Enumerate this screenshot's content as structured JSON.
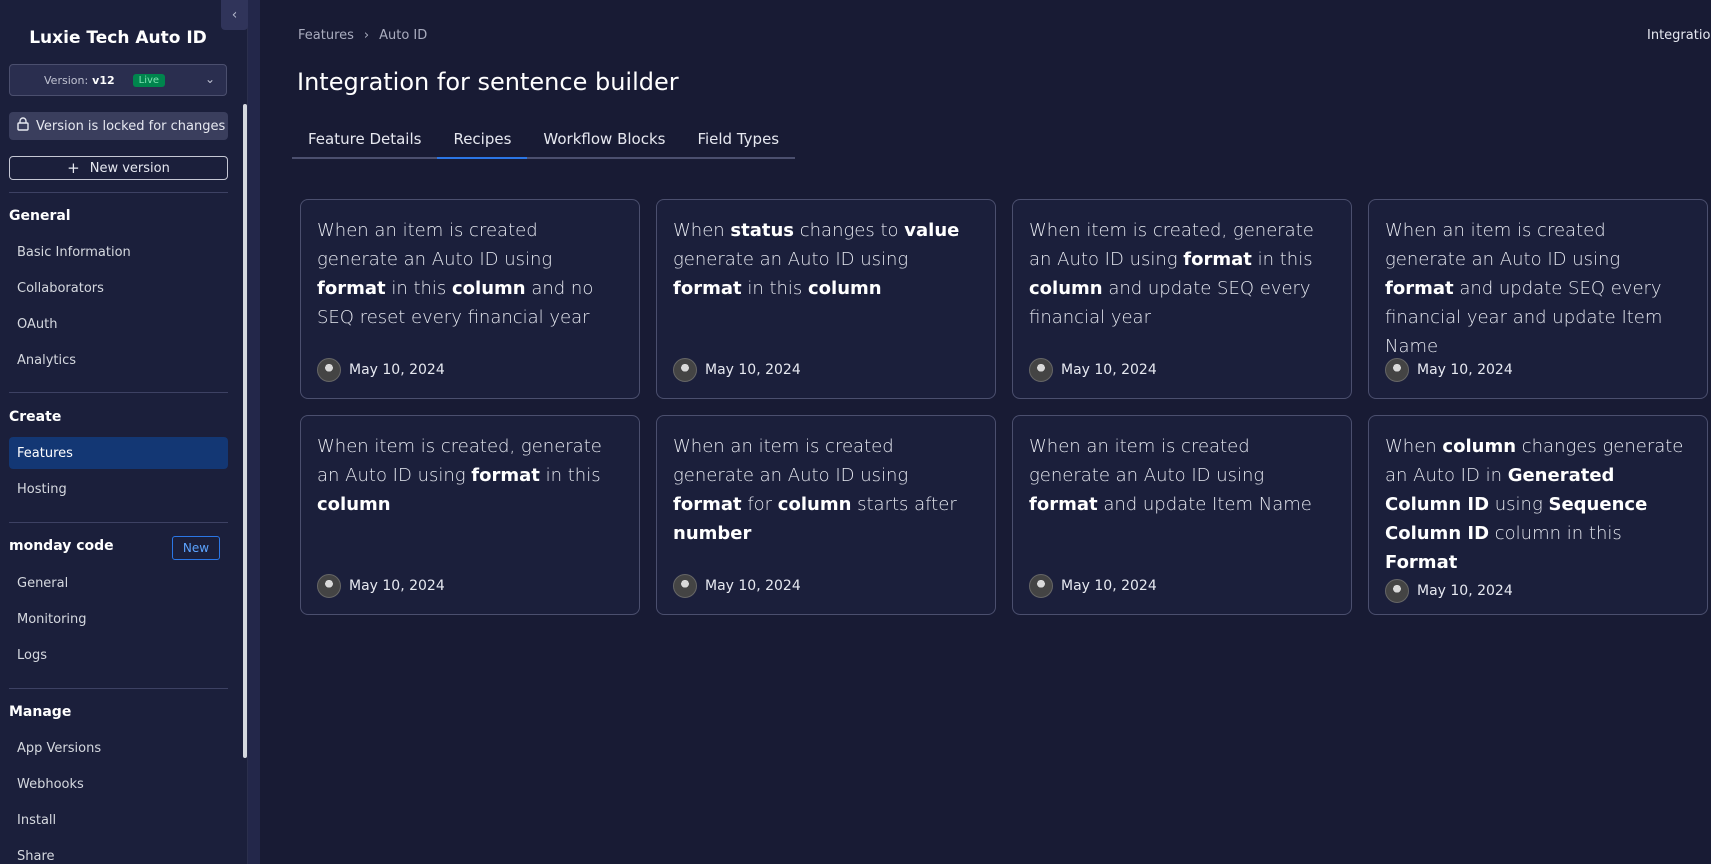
{
  "sidebar": {
    "app_title": "Luxie Tech Auto ID",
    "collapse_icon": "chevron-left-icon",
    "version": {
      "prefix": "Version:",
      "value": "v12",
      "status": "Live"
    },
    "locked_text": "Version is locked for changes",
    "new_version_label": "New version",
    "sections": {
      "general": {
        "title": "General",
        "items": [
          "Basic Information",
          "Collaborators",
          "OAuth",
          "Analytics"
        ]
      },
      "create": {
        "title": "Create",
        "items": [
          "Features",
          "Hosting"
        ],
        "active": "Features"
      },
      "monday_code": {
        "title": "monday code",
        "badge": "New",
        "items": [
          "General",
          "Monitoring",
          "Logs"
        ]
      },
      "manage": {
        "title": "Manage",
        "items": [
          "App Versions",
          "Webhooks",
          "Install",
          "Share"
        ]
      }
    }
  },
  "main": {
    "breadcrumb": [
      "Features",
      "Auto ID"
    ],
    "top_right_text": "Integration",
    "title": "Integration for sentence builder",
    "tabs": [
      "Feature Details",
      "Recipes",
      "Workflow Blocks",
      "Field Types"
    ],
    "active_tab": "Recipes",
    "cards": [
      {
        "segments": [
          [
            "When an item is created generate an Auto ID using ",
            false
          ],
          [
            "format",
            true
          ],
          [
            " in this ",
            false
          ],
          [
            "column",
            true
          ],
          [
            " and no SEQ reset every financial year",
            false
          ]
        ],
        "date": "May 10, 2024"
      },
      {
        "segments": [
          [
            "When ",
            false
          ],
          [
            "status",
            true
          ],
          [
            " changes to ",
            false
          ],
          [
            "value",
            true
          ],
          [
            " generate an Auto ID using ",
            false
          ],
          [
            "format",
            true
          ],
          [
            " in this ",
            false
          ],
          [
            "column",
            true
          ]
        ],
        "date": "May 10, 2024"
      },
      {
        "segments": [
          [
            "When item is created, generate an Auto ID using ",
            false
          ],
          [
            "format",
            true
          ],
          [
            " in this ",
            false
          ],
          [
            "column",
            true
          ],
          [
            " and update SEQ every financial year",
            false
          ]
        ],
        "date": "May 10, 2024"
      },
      {
        "segments": [
          [
            "When an item is created generate an Auto ID using ",
            false
          ],
          [
            "format",
            true
          ],
          [
            " and update SEQ every financial year and update Item Name",
            false
          ]
        ],
        "date": "May 10, 2024"
      },
      {
        "segments": [
          [
            "When item is created, generate an Auto ID using ",
            false
          ],
          [
            "format",
            true
          ],
          [
            " in this ",
            false
          ],
          [
            "column",
            true
          ]
        ],
        "date": "May 10, 2024"
      },
      {
        "segments": [
          [
            "When an item is created generate an Auto ID using ",
            false
          ],
          [
            "format",
            true
          ],
          [
            " for ",
            false
          ],
          [
            "column",
            true
          ],
          [
            " starts after ",
            false
          ],
          [
            "number",
            true
          ]
        ],
        "date": "May 10, 2024"
      },
      {
        "segments": [
          [
            "When an item is created generate an Auto ID using ",
            false
          ],
          [
            "format",
            true
          ],
          [
            " and update Item Name",
            false
          ]
        ],
        "date": "May 10, 2024"
      },
      {
        "segments": [
          [
            "When ",
            false
          ],
          [
            "column",
            true
          ],
          [
            " changes generate an Auto ID in ",
            false
          ],
          [
            "Generated Column ID",
            true
          ],
          [
            " using ",
            false
          ],
          [
            "Sequence Column ID",
            true
          ],
          [
            " column in this ",
            false
          ],
          [
            "Format",
            true
          ]
        ],
        "date": "May 10, 2024"
      }
    ]
  }
}
